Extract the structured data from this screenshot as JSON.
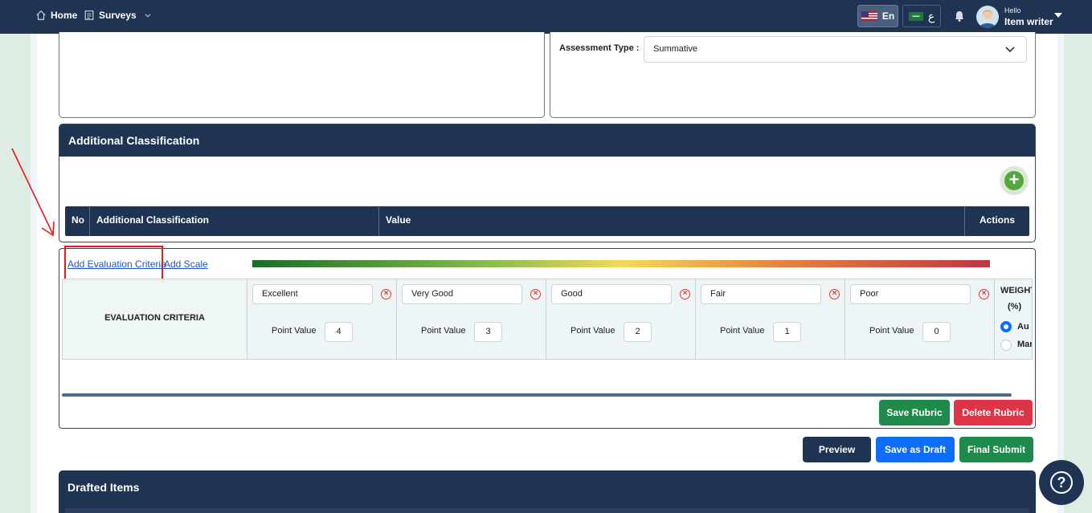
{
  "nav": {
    "home": "Home",
    "surveys": "Surveys"
  },
  "lang": {
    "en": "En",
    "ar": "ع"
  },
  "user": {
    "greeting": "Hello",
    "name": "Item writer"
  },
  "assessment": {
    "label": "Assessment Type :",
    "value": "Summative"
  },
  "additional_classification": {
    "title": "Additional Classification",
    "columns": [
      "No",
      "Additional Classification",
      "Value",
      "Actions"
    ]
  },
  "rubric": {
    "add_criteria": "Add Evaluation Criteria",
    "add_scale": "Add Scale",
    "criteria_header": "EVALUATION CRITERIA",
    "point_value_label": "Point Value",
    "scales": [
      {
        "name": "Excellent",
        "points": "4"
      },
      {
        "name": "Very Good",
        "points": "3"
      },
      {
        "name": "Good",
        "points": "2"
      },
      {
        "name": "Fair",
        "points": "1"
      },
      {
        "name": "Poor",
        "points": "0"
      }
    ],
    "weight_line1": "WEIGHT",
    "weight_line2": "(%)",
    "weight_options": [
      "Au",
      "Mar"
    ],
    "save": "Save Rubric",
    "delete": "Delete Rubric"
  },
  "actions": {
    "preview": "Preview",
    "draft": "Save as Draft",
    "submit": "Final Submit"
  },
  "drafted": {
    "title": "Drafted Items"
  },
  "help": "?",
  "colors": {
    "navy": "#1f3352",
    "green": "#1e8a4c",
    "red": "#dc3545",
    "blue": "#0d6efd",
    "annotation": "#e41b1b"
  }
}
